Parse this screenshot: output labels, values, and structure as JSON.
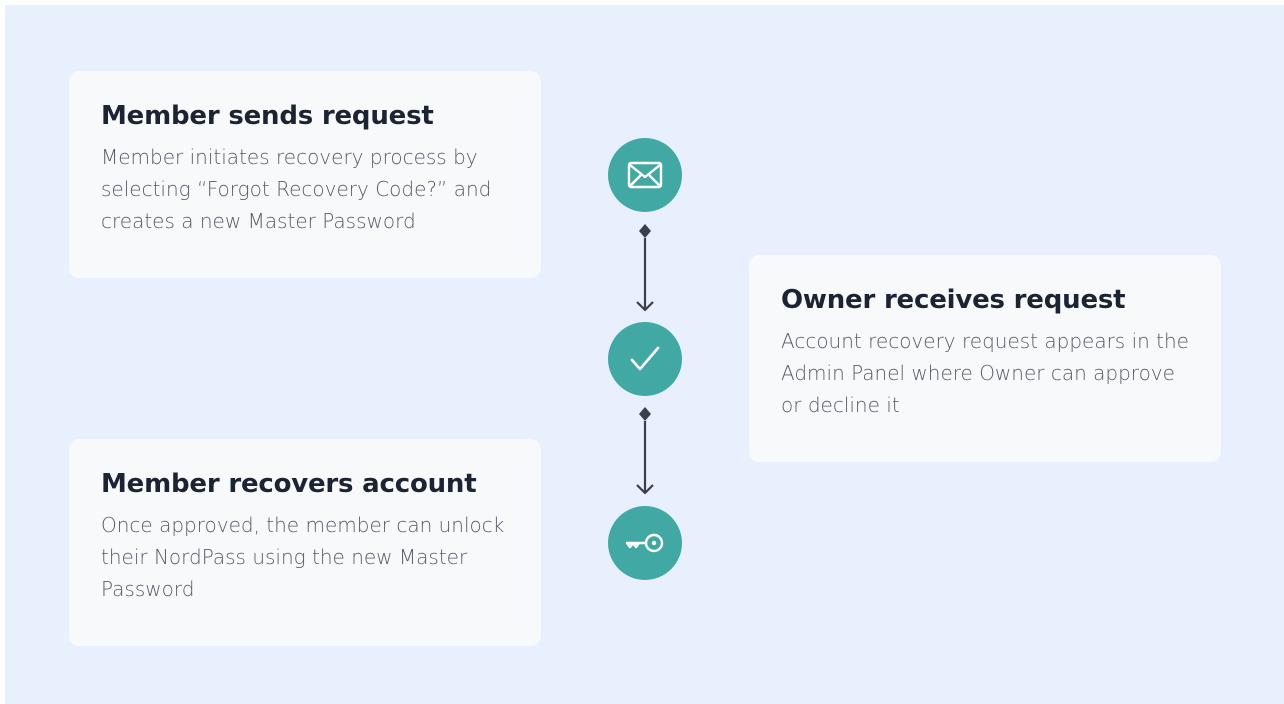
{
  "steps": [
    {
      "title": "Member sends request",
      "description": "Member initiates recovery process by selecting “Forgot Recovery Code?” and creates a new Master Password",
      "icon": "envelope-icon"
    },
    {
      "title": "Owner receives request",
      "description": "Account recovery request appears in the Admin Panel where Owner can approve or decline it",
      "icon": "checkmark-icon"
    },
    {
      "title": "Member recovers account",
      "description": "Once approved, the member can unlock their NordPass using the new Master Password",
      "icon": "key-icon"
    }
  ],
  "colors": {
    "background": "#e8f0fe",
    "card": "#f7f9fb",
    "icon_circle": "#42a8a3",
    "connector": "#3a3f4a",
    "title": "#1c2333",
    "body_text": "#575c66"
  }
}
